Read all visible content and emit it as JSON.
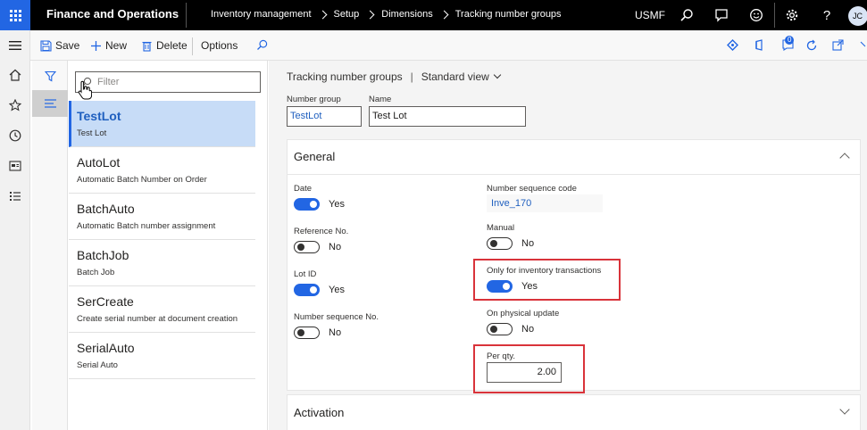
{
  "topbar": {
    "app_title": "Finance and Operations",
    "breadcrumbs": [
      "Inventory management",
      "Setup",
      "Dimensions",
      "Tracking number groups"
    ],
    "company": "USMF",
    "avatar_initials": "JC"
  },
  "actions": {
    "save": "Save",
    "new": "New",
    "delete": "Delete",
    "options": "Options",
    "notification_count": "0"
  },
  "list": {
    "filter_placeholder": "Filter",
    "items": [
      {
        "title": "TestLot",
        "subtitle": "Test Lot"
      },
      {
        "title": "AutoLot",
        "subtitle": "Automatic Batch Number on Order"
      },
      {
        "title": "BatchAuto",
        "subtitle": "Automatic Batch number assignment"
      },
      {
        "title": "BatchJob",
        "subtitle": "Batch Job"
      },
      {
        "title": "SerCreate",
        "subtitle": "Create serial number at document creation"
      },
      {
        "title": "SerialAuto",
        "subtitle": "Serial Auto"
      }
    ]
  },
  "details": {
    "page_title": "Tracking number groups",
    "view_name": "Standard view",
    "number_group_label": "Number group",
    "number_group_value": "TestLot",
    "name_label": "Name",
    "name_value": "Test Lot"
  },
  "general": {
    "title": "General",
    "date_label": "Date",
    "date_value": "Yes",
    "ref_label": "Reference No.",
    "ref_value": "No",
    "lotid_label": "Lot ID",
    "lotid_value": "Yes",
    "numseq_label": "Number sequence No.",
    "numseq_value": "No",
    "seqcode_label": "Number sequence code",
    "seqcode_value": "Inve_170",
    "manual_label": "Manual",
    "manual_value": "No",
    "inventonly_label": "Only for inventory transactions",
    "inventonly_value": "Yes",
    "physical_label": "On physical update",
    "physical_value": "No",
    "perqty_label": "Per qty.",
    "perqty_value": "2.00"
  },
  "activation": {
    "title": "Activation"
  },
  "colors": {
    "accent": "#2266e3",
    "highlight": "#d9333a",
    "selected_row": "#c7dcf7"
  }
}
